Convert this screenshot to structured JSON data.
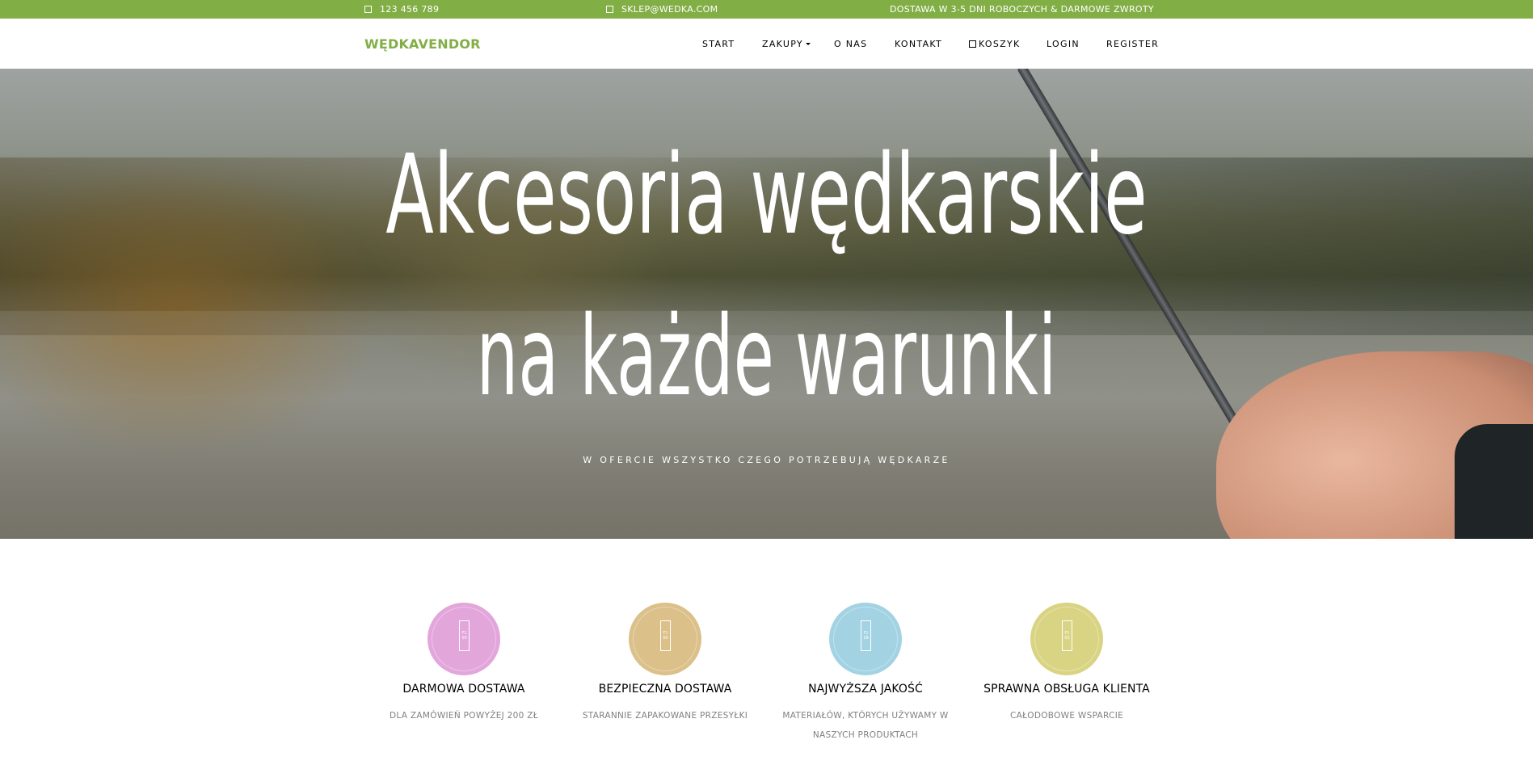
{
  "topbar": {
    "phone": "123 456 789",
    "email": "SKLEP@WEDKA.COM",
    "shipping_note": "DOSTAWA W 3-5 DNI ROBOCZYCH & DARMOWE ZWROTY",
    "phone_icon": "phone-icon",
    "email_icon": "mail-icon"
  },
  "brand": {
    "name": "WĘDKAVENDOR",
    "color": "#82ae46"
  },
  "nav": {
    "items": [
      {
        "label": "START"
      },
      {
        "label": "ZAKUPY",
        "has_dropdown": true
      },
      {
        "label": "O NAS"
      },
      {
        "label": "KONTAKT"
      },
      {
        "label": "KOSZYK",
        "icon": "cart-icon"
      },
      {
        "label": "LOGIN"
      },
      {
        "label": "REGISTER"
      }
    ]
  },
  "hero": {
    "title_line1": "Akcesoria wędkarskie",
    "title_line2": "na każde warunki",
    "subtitle": "W OFERCIE WSZYSTKO CZEGO POTRZEBUJĄ WĘDKARZE"
  },
  "features": [
    {
      "title": "DARMOWA DOSTAWA",
      "text": "DLA ZAMÓWIEŃ POWYŻEJ 200 ZŁ",
      "color": "#e3a6db",
      "icon": "F1 00"
    },
    {
      "title": "BEZPIECZNA DOSTAWA",
      "text": "STARANNIE ZAPAKOWANE PRZESYŁKI",
      "color": "#dcc08a",
      "icon": "F1 00"
    },
    {
      "title": "NAJWYŻSZA JAKOŚĆ",
      "text": "MATERIAŁÓW, KTÓRYCH UŻYWAMY W NASZYCH PRODUKTACH",
      "color": "#a3d3e3",
      "icon": "F1 1B"
    },
    {
      "title": "SPRAWNA OBSŁUGA KLIENTA",
      "text": "CAŁODOBOWE WSPARCIE",
      "color": "#d9d483",
      "icon": "F1 03"
    }
  ],
  "colors": {
    "accent": "#82ae46"
  }
}
